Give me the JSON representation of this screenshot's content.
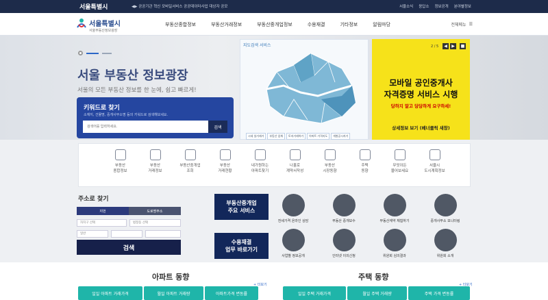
{
  "topbar": {
    "brand": "서울특별시",
    "notice": "◀▶ 공공기관 혁신 모바일서비스 공공데이터사업 대상자 공모",
    "links": [
      "서울소식",
      "응답소",
      "정보공개",
      "분야별정보"
    ]
  },
  "nav": {
    "logo_title": "서울특별시",
    "logo_sub": "서울부동산정보광장",
    "menu": [
      "부동산종합정보",
      "부동산거래정보",
      "부동산중개업정보",
      "수용재결",
      "기타정보",
      "알림마당"
    ],
    "all_menu": "전체메뉴"
  },
  "hero": {
    "title": "서울 부동산 정보광장",
    "subtitle": "서울의 모든 부동산 정보를 한 눈에, 쉽고 빠르게!"
  },
  "keyword": {
    "title": "키워드로 찾기",
    "desc": "소재지, 건물명, 중개사무소명 등의 키워드로 검색해보세요.",
    "placeholder": "검색어를 입력하세요.",
    "button": "검색"
  },
  "map": {
    "label": "지도검색 서비스",
    "tags": [
      "시세 실거래가",
      "부동산 업체",
      "토지거래허가",
      "아파트 가격지도",
      "개발공시지가"
    ]
  },
  "ad": {
    "page": "2 / 5",
    "prev": "◀",
    "next": "▶",
    "pause": "■",
    "line1": "모바일 공인중개사",
    "line2": "자격증명 서비스 시행",
    "line3": "당하지 말고 당당하게 요구하세!",
    "more": "상세정보 보기 (베너클릭 새창)"
  },
  "services": [
    {
      "l1": "부동산",
      "l2": "종합정보"
    },
    {
      "l1": "부동산",
      "l2": "거래정보"
    },
    {
      "l1": "부동산중개업",
      "l2": "조회"
    },
    {
      "l1": "부동산",
      "l2": "거래현황"
    },
    {
      "l1": "내가원하는",
      "l2": "아파트찾기"
    },
    {
      "l1": "나홀로",
      "l2": "계약서작성"
    },
    {
      "l1": "부동산",
      "l2": "시장동향"
    },
    {
      "l1": "주택",
      "l2": "동향"
    },
    {
      "l1": "무엇이든",
      "l2": "물어보세요"
    },
    {
      "l1": "서울시",
      "l2": "도시계획정보"
    }
  ],
  "address": {
    "title": "주소로 찾기",
    "tab1": "지번",
    "tab2": "도로명주소",
    "sel1": "자치구 선택",
    "sel2": "법정동 선택",
    "sel3": "일반",
    "search": "검색"
  },
  "svcbox1": [
    "부동산중개업",
    "주요 서비스"
  ],
  "svcbox2": [
    "수용재결",
    "업무 바로가기"
  ],
  "circles": [
    "전세가격 온라인 상담",
    "부동산 중개보수",
    "부동산계약 체험하기",
    "중개사무소 모니터링",
    "사업별 정보공개",
    "인터넷 이의신청",
    "위원회 심의결과",
    "위원회 소개"
  ],
  "trends": {
    "apt": "아파트 동향",
    "house": "주택 동향",
    "more": "+ 더보기",
    "apt_tabs": [
      "일일 아파트 거래가격",
      "월일 아파트 거래량",
      "아파트가격 변동률"
    ],
    "house_tabs": [
      "일일 주택 거래가격",
      "월일 주택 거래량",
      "주택 가격 변동률"
    ]
  }
}
